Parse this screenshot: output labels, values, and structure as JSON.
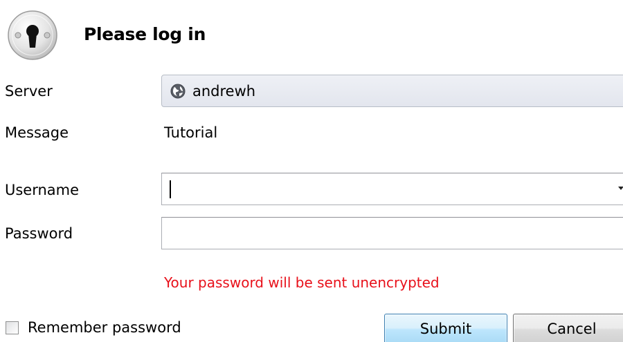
{
  "dialog": {
    "title": "Please log in",
    "header_icon": "keyhole-lock-icon"
  },
  "server": {
    "label": "Server",
    "value": "andrewh",
    "icon": "globe-icon"
  },
  "message": {
    "label": "Message",
    "value": "Tutorial"
  },
  "username": {
    "label": "Username",
    "value": ""
  },
  "password": {
    "label": "Password",
    "value": ""
  },
  "warning": {
    "text": "Your password will be sent unencrypted",
    "color": "#e8101a"
  },
  "remember": {
    "label": "Remember password",
    "checked": false
  },
  "buttons": {
    "submit_label": "Submit",
    "cancel_label": "Cancel"
  }
}
